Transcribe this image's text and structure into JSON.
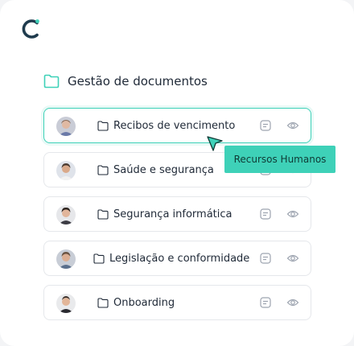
{
  "section": {
    "title": "Gestão de documentos",
    "icon": "folder-icon"
  },
  "documents": [
    {
      "title": "Recibos de vencimento"
    },
    {
      "title": "Saúde e segurança"
    },
    {
      "title": "Segurança informática"
    },
    {
      "title": "Legislação e conformidade"
    },
    {
      "title": "Onboarding"
    }
  ],
  "tooltip": {
    "text": "Recursos Humanos"
  },
  "colors": {
    "accent": "#3ed1b8",
    "dark": "#1f3b4d",
    "border": "#e5e7eb"
  }
}
